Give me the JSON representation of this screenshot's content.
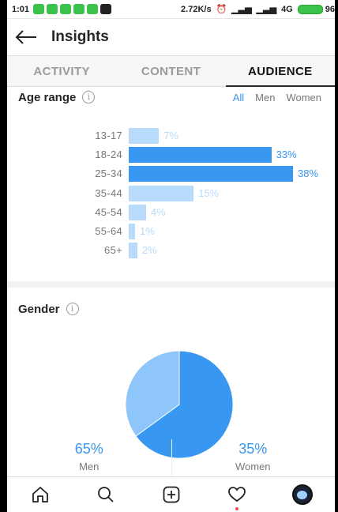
{
  "status_bar": {
    "time": "1:01",
    "notification_colors": [
      "#3bc24a",
      "#3bc24a",
      "#3bc24a",
      "#3bc24a",
      "#3bc24a",
      "#222222"
    ],
    "speed": "2.72K/s",
    "network": "4G",
    "battery": "96"
  },
  "header": {
    "title": "Insights",
    "back_icon": "arrow-left-icon"
  },
  "tabs": [
    {
      "label": "ACTIVITY",
      "active": false
    },
    {
      "label": "CONTENT",
      "active": false
    },
    {
      "label": "AUDIENCE",
      "active": true
    }
  ],
  "age_range": {
    "title": "Age range",
    "info_icon": "info-icon",
    "filters": [
      {
        "label": "All",
        "selected": true
      },
      {
        "label": "Men",
        "selected": false
      },
      {
        "label": "Women",
        "selected": false
      }
    ],
    "chart_data": {
      "type": "bar",
      "orientation": "horizontal",
      "categories": [
        "13-17",
        "18-24",
        "25-34",
        "35-44",
        "45-54",
        "55-64",
        "65+"
      ],
      "values": [
        7,
        33,
        38,
        15,
        4,
        1,
        2
      ],
      "value_labels": [
        "7%",
        "33%",
        "38%",
        "15%",
        "4%",
        "1%",
        "2%"
      ],
      "highlight": [
        false,
        true,
        true,
        false,
        false,
        false,
        false
      ],
      "unit": "%",
      "max": 38,
      "colors": {
        "strong": "#3897f0",
        "light": "#b8dafb",
        "strong_text": "#3897f0",
        "light_text": "#b8dafb"
      }
    }
  },
  "gender": {
    "title": "Gender",
    "info_icon": "info-icon",
    "chart_data": {
      "type": "pie",
      "categories": [
        "Men",
        "Women"
      ],
      "values": [
        65,
        35
      ],
      "colors": [
        "#3897f0",
        "#8ec5fa"
      ]
    },
    "stats": [
      {
        "value": "65%",
        "label": "Men"
      },
      {
        "value": "35%",
        "label": "Women"
      }
    ]
  },
  "bottom_nav": [
    {
      "name": "home-icon"
    },
    {
      "name": "search-icon"
    },
    {
      "name": "add-post-icon"
    },
    {
      "name": "activity-heart-icon",
      "notification": true
    },
    {
      "name": "profile-avatar"
    }
  ]
}
